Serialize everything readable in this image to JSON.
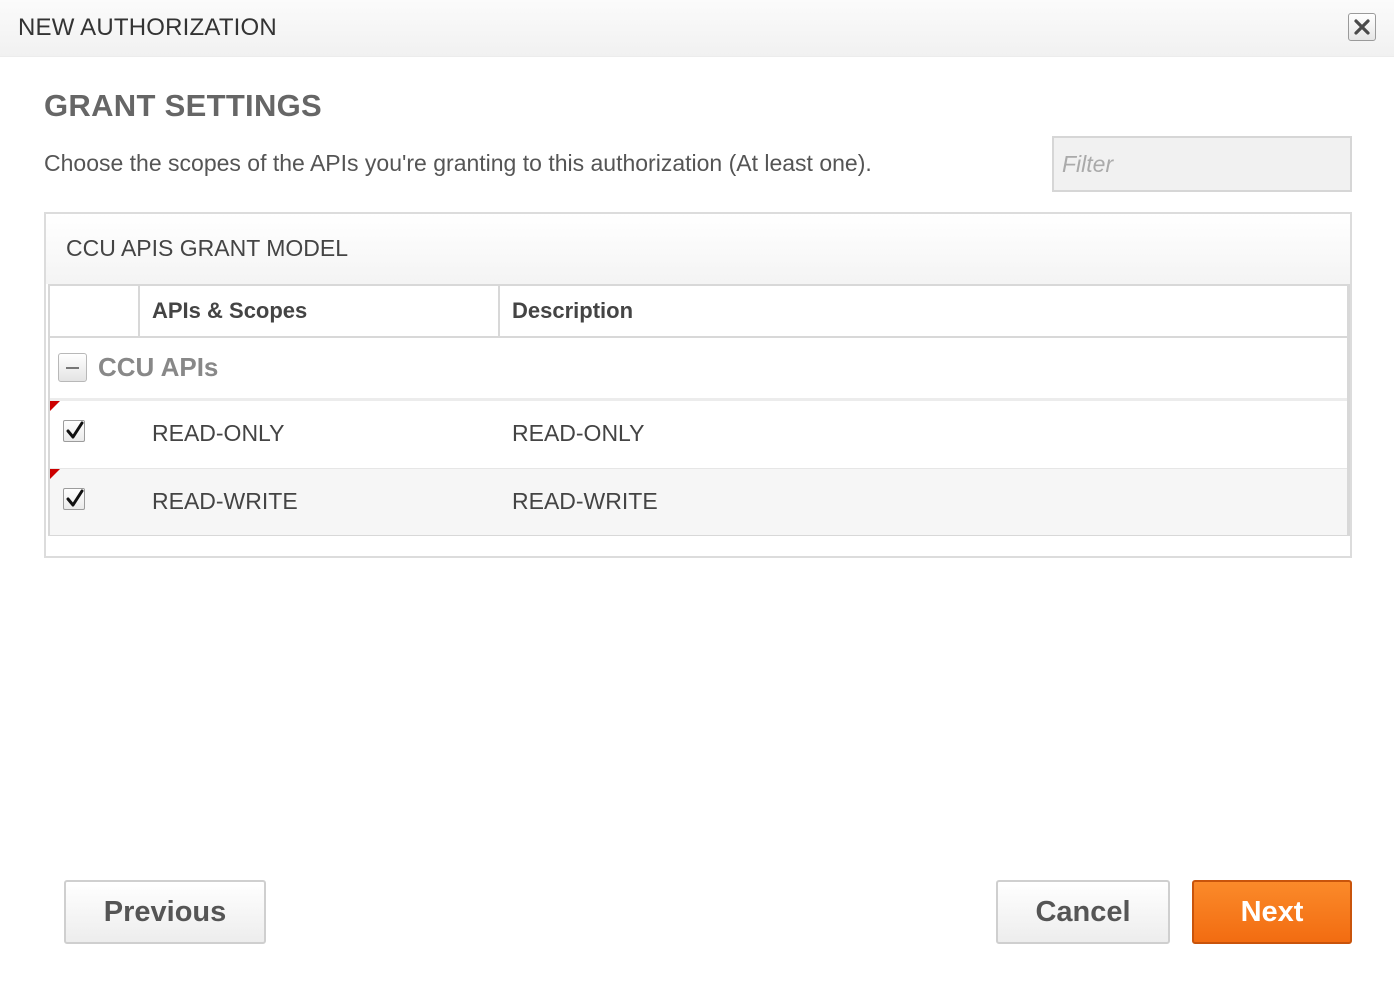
{
  "dialog": {
    "title": "NEW AUTHORIZATION",
    "close_icon": "close-icon"
  },
  "section": {
    "heading": "GRANT SETTINGS",
    "instructions": "Choose the scopes of the APIs you're granting to this authorization (At least one)."
  },
  "filter": {
    "placeholder": "Filter",
    "value": ""
  },
  "grant_model": {
    "title": "CCU APIS GRANT MODEL",
    "columns": {
      "select": "",
      "scope": "APIs & Scopes",
      "description": "Description"
    },
    "group": {
      "label": "CCU APIs",
      "expanded": true,
      "toggle_icon": "collapse-icon"
    },
    "rows": [
      {
        "scope": "READ-ONLY",
        "description": "READ-ONLY",
        "checked": true,
        "modified": true
      },
      {
        "scope": "READ-WRITE",
        "description": "READ-WRITE",
        "checked": true,
        "modified": true
      }
    ]
  },
  "buttons": {
    "previous": "Previous",
    "cancel": "Cancel",
    "next": "Next"
  },
  "colors": {
    "accent": "#f47c20",
    "accent_border": "#c9540b",
    "modified_flag": "#cc0000",
    "heading": "#666666"
  }
}
